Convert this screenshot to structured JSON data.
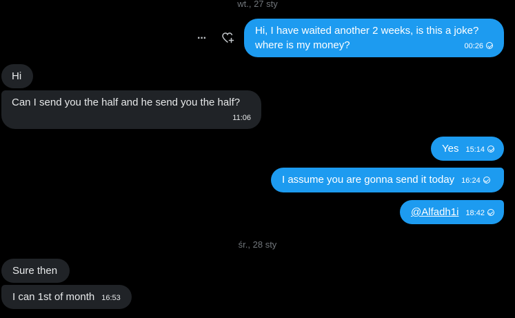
{
  "date_separators": [
    "wt., 27 sty",
    "śr., 28 sty"
  ],
  "messages": [
    {
      "direction": "out",
      "text_line1": "Hi, I have waited another 2 weeks, is this a joke?",
      "text_line2": "where is my money?",
      "time": "00:26",
      "read": true
    },
    {
      "direction": "in",
      "text": "Hi"
    },
    {
      "direction": "in",
      "text": "Can I send you the half and he send you the half?",
      "time": "11:06"
    },
    {
      "direction": "out",
      "text": "Yes",
      "time": "15:14",
      "read": true
    },
    {
      "direction": "out",
      "text": "I assume you are gonna send it today",
      "time": "16:24",
      "read": true
    },
    {
      "direction": "out",
      "text": "@Alfadh1i",
      "time": "18:42",
      "read": true
    },
    {
      "direction": "in",
      "text": "Sure then"
    },
    {
      "direction": "in",
      "text": "I can 1st of month",
      "time": "16:53"
    }
  ],
  "actions": {
    "more_glyph": "···",
    "react_glyph": "♡"
  },
  "colors": {
    "background": "#000000",
    "outgoing_bubble": "#1d9bf0",
    "incoming_bubble": "#202327",
    "muted_text": "#71767b"
  }
}
